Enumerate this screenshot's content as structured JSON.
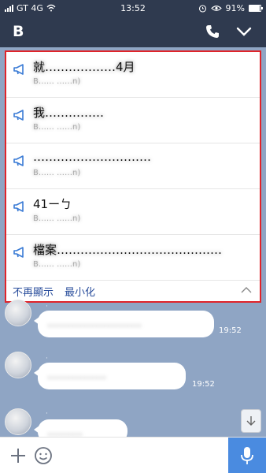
{
  "status_bar": {
    "carrier": "GT 4G",
    "time": "13:52",
    "battery": "91%",
    "battery_level": 0.91
  },
  "header": {
    "title": "B",
    "icons": [
      "phone-icon",
      "chevron-down-icon"
    ]
  },
  "announcements": {
    "items": [
      {
        "text": "就………………4月",
        "meta": "B…… ……n)"
      },
      {
        "text": "我……………",
        "meta": "B…… ……n)"
      },
      {
        "text": "…………………………",
        "meta": "B…… ……n)"
      },
      {
        "text": "41ーㄅ",
        "meta": "B…… ……n)"
      },
      {
        "text": "檔案……………………………………",
        "meta": "B…… ……n)"
      }
    ],
    "footer": {
      "hide_label": "不再顯示",
      "minimize_label": "最小化"
    }
  },
  "chat": {
    "messages": [
      {
        "text": "……………………",
        "time": "19:52"
      },
      {
        "text": "……………",
        "time": "19:52"
      },
      {
        "text": "………",
        "time": ""
      }
    ]
  },
  "colors": {
    "header_bg": "#2f3a4f",
    "panel_border": "#e0242a",
    "link": "#2a4e9c",
    "chat_bg": "#8fa5c4",
    "mic_bg": "#4a8be0"
  }
}
